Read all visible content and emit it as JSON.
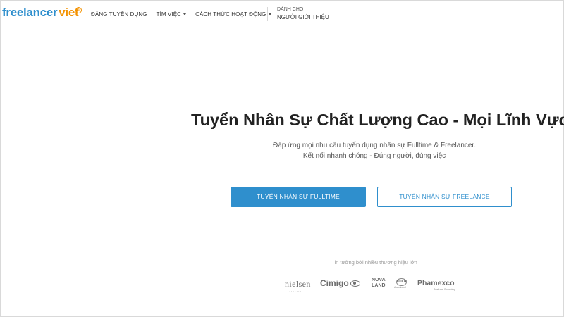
{
  "header": {
    "logo": {
      "part1": "freelancer",
      "part2": "viet",
      "registered": "®"
    },
    "nav": [
      {
        "label": "ĐĂNG TUYỂN DỤNG",
        "has_caret": false
      },
      {
        "label": "TÌM VIỆC",
        "has_caret": true
      },
      {
        "label": "CÁCH THỨC HOẠT ĐỘNG",
        "has_caret": true
      }
    ],
    "referrer": {
      "small": "DÀNH CHO",
      "main": "NGƯỜI GIỚI THIỆU"
    }
  },
  "hero": {
    "title": "Tuyển Nhân Sự Chất Lượng Cao - Mọi Lĩnh Vực",
    "subtitle_line1": "Đáp ứng mọi nhu cầu tuyển dụng nhân sự Fulltime & Freelancer.",
    "subtitle_line2": "Kết nối nhanh chóng - Đúng người, đúng việc",
    "primary_button": "TUYỂN NHÂN SỰ FULLTIME",
    "secondary_button": "TUYỂN NHÂN SỰ FREELANCE"
  },
  "trust": {
    "label": "Tin tưởng bởi nhiều thương hiệu lớn",
    "partners": {
      "nielsen": "nielsen",
      "cimigo": "Cimigo",
      "nova_line1": "NOVA",
      "nova_line2": "LAND",
      "dulux": "Dulux",
      "dulux_sub": "AkzoNobel",
      "phamexco": "Phamexco",
      "phamexco_sub": "Natural Sourcing"
    }
  },
  "colors": {
    "primary": "#2f8fcd",
    "accent": "#f39200",
    "text": "#222222"
  },
  "icons": [
    "caret-down-icon",
    "registered-icon",
    "cimigo-eye-icon"
  ]
}
